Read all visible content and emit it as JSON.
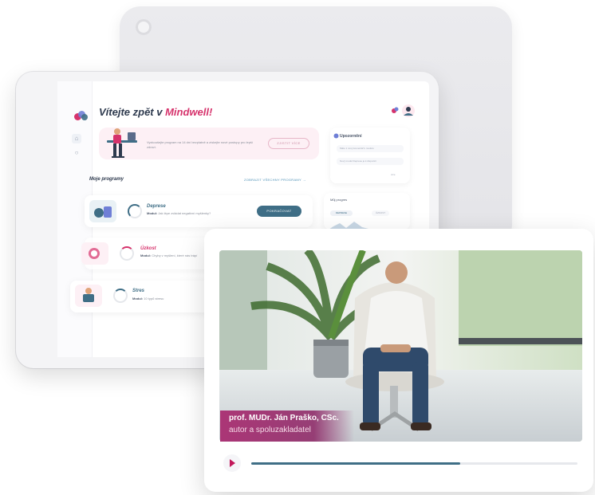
{
  "app": {
    "welcome_prefix": "Vítejte zpět v",
    "welcome_brand": "Mindwell!",
    "brand_color": "#d6336c",
    "accent_color": "#3f6e86"
  },
  "sidebar": {
    "icons": [
      "home-icon",
      "chat-icon",
      "settings-icon",
      "logout-icon"
    ]
  },
  "hero": {
    "text": "Vyzkoušejte program na 14 dní bezplatně a získejte nové postupy pro lepší zdraví.",
    "button_label": "ZJISTIT VÍCE"
  },
  "notes": {
    "title": "Upozornění",
    "rows": [
      "Máte 1 nový komentář k modulu",
      "Nový modul Deprese je k dispozici"
    ],
    "more_label": "více"
  },
  "programs": {
    "section_title": "Moje programy",
    "see_all_label": "ZOBRAZIT VŠECHNY PROGRAMY →",
    "items": [
      {
        "name": "Deprese",
        "module_label": "Modul:",
        "module": "Jak lépe zvládat negativní myšlenky?",
        "progress": 0.35,
        "color": "#3f6e86"
      },
      {
        "name": "Úzkost",
        "module_label": "Modul:",
        "module": "Chyby v myšlení, které nás trápí",
        "progress": 0.15,
        "color": "#d6336c"
      },
      {
        "name": "Stres",
        "module_label": "Modul:",
        "module": "10 typů stresu",
        "progress": 0.1,
        "color": "#3f6e86"
      }
    ],
    "continue_label": "POKRAČOVAT"
  },
  "progress_widget": {
    "title": "Můj progres",
    "tabs": [
      "DEPRESE",
      "ÚZKOST"
    ]
  },
  "video": {
    "presenter_name": "prof. MUDr. Ján Praško, CSc.",
    "presenter_role": "autor a spoluzakladatel",
    "playback_progress": 0.64,
    "play_icon": "play-icon"
  }
}
